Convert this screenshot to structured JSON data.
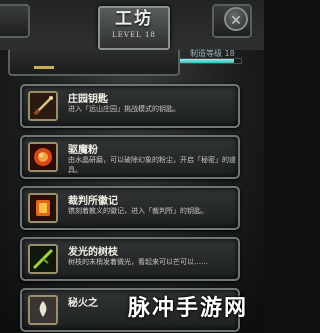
{
  "header": {
    "title": "工坊",
    "subtitle": "LEVEL 18",
    "close_glyph": "✕",
    "level_label": "制造等级 18",
    "level_progress": 0.9
  },
  "items": [
    {
      "name": "庄园钥匙",
      "desc": "进入「远山庄园」挑战模式的钥匙。",
      "icon": "sword-key-icon"
    },
    {
      "name": "驱魔粉",
      "desc": "由水晶研磨，可以破除幻象的粉尘，开启「秘密」的道具。",
      "icon": "exorcism-powder-icon"
    },
    {
      "name": "裁判所徽记",
      "desc": "镌刻着教义的徽记，进入「裁判所」的钥匙。",
      "icon": "tribunal-emblem-icon"
    },
    {
      "name": "发光的树枝",
      "desc": "树枝的末梢发着微光，看起来可以芒可以……",
      "icon": "glowing-branch-icon"
    },
    {
      "name": "秘火之",
      "desc": "",
      "icon": "secret-fire-icon"
    }
  ],
  "watermark": "脉冲手游网",
  "colors": {
    "accent_cyan": "#6fe3df",
    "frame_gray": "#707575",
    "text_light": "#f3f1e6",
    "gold": "#c9ae54"
  }
}
